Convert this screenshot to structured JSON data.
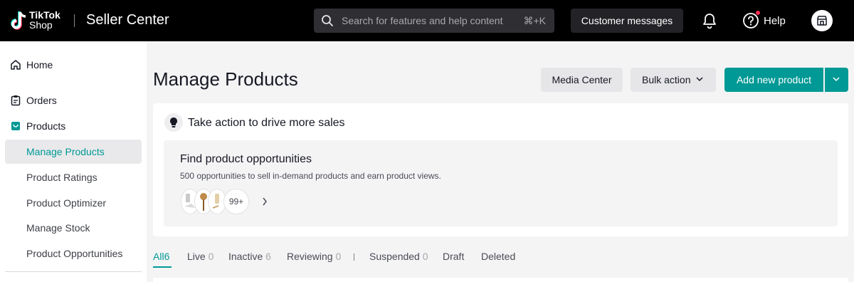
{
  "topbar": {
    "logo_line1": "TikTok",
    "logo_line2": "Shop",
    "app_title": "Seller Center",
    "search_placeholder": "Search for features and help content",
    "search_shortcut": "⌘+K",
    "customer_messages": "Customer messages",
    "help": "Help",
    "icons": [
      "tiktok-logo-icon",
      "search-icon",
      "bell-icon",
      "help-icon",
      "shop-icon"
    ]
  },
  "sidebar": {
    "items": [
      {
        "label": "Home",
        "icon": "home-icon"
      },
      {
        "label": "Orders",
        "icon": "clipboard-icon"
      },
      {
        "label": "Products",
        "icon": "product-box-icon"
      }
    ],
    "product_subitems": [
      {
        "label": "Manage Products",
        "active": true
      },
      {
        "label": "Product Ratings"
      },
      {
        "label": "Product Optimizer"
      },
      {
        "label": "Manage Stock"
      },
      {
        "label": "Product Opportunities"
      }
    ]
  },
  "main": {
    "title": "Manage Products",
    "media_center": "Media Center",
    "bulk_action": "Bulk action",
    "add_new_product": "Add new product",
    "card": {
      "title": "Take action to drive more sales",
      "opportunity_title": "Find product opportunities",
      "opportunity_desc": "500 opportunities to sell in-demand products and earn product views.",
      "more_count": "99+"
    },
    "tabs": [
      {
        "label": "All",
        "count": "6",
        "active": true
      },
      {
        "label": "Live",
        "count": "0"
      },
      {
        "label": "Inactive",
        "count": "6"
      },
      {
        "label": "Reviewing",
        "count": "0"
      },
      {
        "label": "Suspended",
        "count": "0"
      },
      {
        "label": "Draft",
        "count": ""
      },
      {
        "label": "Deleted",
        "count": ""
      }
    ]
  },
  "colors": {
    "accent": "#009995",
    "topbar_bg": "#000000",
    "notification_dot": "#fe2c55"
  }
}
